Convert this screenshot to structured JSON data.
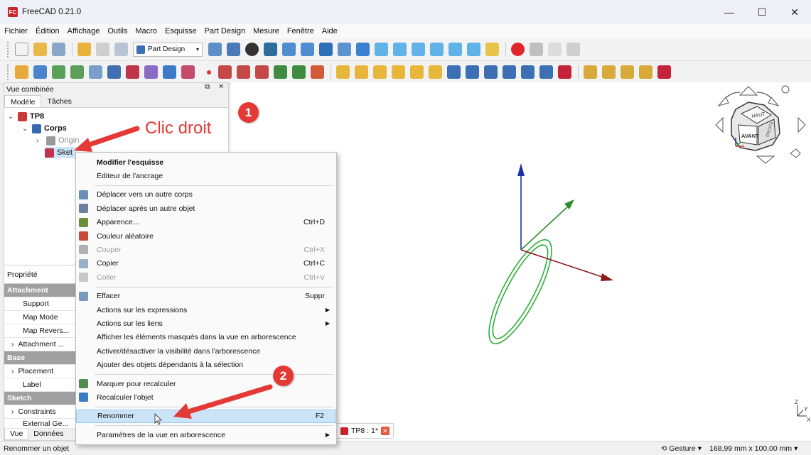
{
  "window": {
    "title": "FreeCAD 0.21.0",
    "logo": "FC",
    "controls": [
      "—",
      "☐",
      "✕"
    ]
  },
  "menu": [
    "Fichier",
    "Édition",
    "Affichage",
    "Outils",
    "Macro",
    "Esquisse",
    "Part Design",
    "Mesure",
    "Fenêtre",
    "Aide"
  ],
  "workbench": {
    "selected": "Part Design"
  },
  "combo": {
    "title": "Vue combinée",
    "tabs": [
      "Modèle",
      "Tâches"
    ],
    "tree": {
      "doc": "TP8",
      "body": "Corps",
      "origin": "Origin",
      "sketch": "Sket"
    },
    "props": {
      "header": "Propriété",
      "rows": [
        {
          "label": "Attachment",
          "kind": "group"
        },
        {
          "label": "Support",
          "kind": "child"
        },
        {
          "label": "Map Mode",
          "kind": "child"
        },
        {
          "label": "Map Revers...",
          "kind": "child"
        },
        {
          "label": "Attachment ...",
          "kind": "exp"
        },
        {
          "label": "Base",
          "kind": "group"
        },
        {
          "label": "Placement",
          "kind": "exp"
        },
        {
          "label": "Label",
          "kind": "child"
        },
        {
          "label": "Sketch",
          "kind": "group"
        },
        {
          "label": "Constraints",
          "kind": "exp"
        },
        {
          "label": "External Ge...",
          "kind": "child"
        }
      ]
    },
    "bottom_tabs": [
      "Vue",
      "Données"
    ]
  },
  "context_menu": [
    {
      "label": "Modifier l'esquisse",
      "bold": true,
      "icon": ""
    },
    {
      "label": "Éditeur de l'ancrage",
      "icon": ""
    },
    {
      "sep": true
    },
    {
      "label": "Déplacer vers un autre corps",
      "icon": "move-body-icon"
    },
    {
      "label": "Déplacer après un autre objet",
      "icon": "move-after-icon"
    },
    {
      "label": "Apparence...",
      "shortcut": "Ctrl+D",
      "icon": "appearance-icon"
    },
    {
      "label": "Couleur aléatoire",
      "icon": "random-color-icon"
    },
    {
      "label": "Couper",
      "shortcut": "Ctrl+X",
      "disabled": true,
      "icon": "cut-icon"
    },
    {
      "label": "Copier",
      "shortcut": "Ctrl+C",
      "icon": "copy-icon"
    },
    {
      "label": "Coller",
      "shortcut": "Ctrl+V",
      "disabled": true,
      "icon": "paste-icon"
    },
    {
      "sep": true
    },
    {
      "label": "Effacer",
      "shortcut": "Suppr",
      "icon": "delete-icon"
    },
    {
      "label": "Actions sur les expressions",
      "submenu": true
    },
    {
      "label": "Actions sur les liens",
      "submenu": true
    },
    {
      "label": "Afficher les éléments masqués dans la vue en arborescence"
    },
    {
      "label": "Activer/désactiver la visibilité dans l'arborescence"
    },
    {
      "label": "Ajouter des objets dépendants à la sélection"
    },
    {
      "sep": true
    },
    {
      "label": "Marquer pour recalculer",
      "icon": "mark-recompute-icon"
    },
    {
      "label": "Recalculer l'objet",
      "icon": "recompute-icon"
    },
    {
      "sep": true
    },
    {
      "label": "Renommer",
      "shortcut": "F2",
      "highlight": true
    },
    {
      "sep": true
    },
    {
      "label": "Paramètres de la vue en arborescence",
      "submenu": true
    }
  ],
  "annotations": {
    "step1": "1",
    "step2": "2",
    "callout": "Clic droit"
  },
  "navcube": {
    "top": "HAUT",
    "front": "AVANT",
    "right": "DROITE"
  },
  "axis_labels": {
    "z": "Z",
    "y": "Y",
    "x": "X"
  },
  "doc_tab": {
    "label": "TP8 : 1*",
    "close": "✕"
  },
  "status": {
    "left": "Renommer un objet",
    "nav": "Gesture",
    "nav_arrow": "▾",
    "dims": "168,99 mm x 100,00 mm",
    "dims_arrow": "▾"
  },
  "colors": {
    "highlight": "#cce4f7",
    "annotation": "#e53935",
    "sketch_green": "#2eaf3a",
    "axis_z": "#1e2fa8",
    "axis_x": "#8b1a1a"
  }
}
